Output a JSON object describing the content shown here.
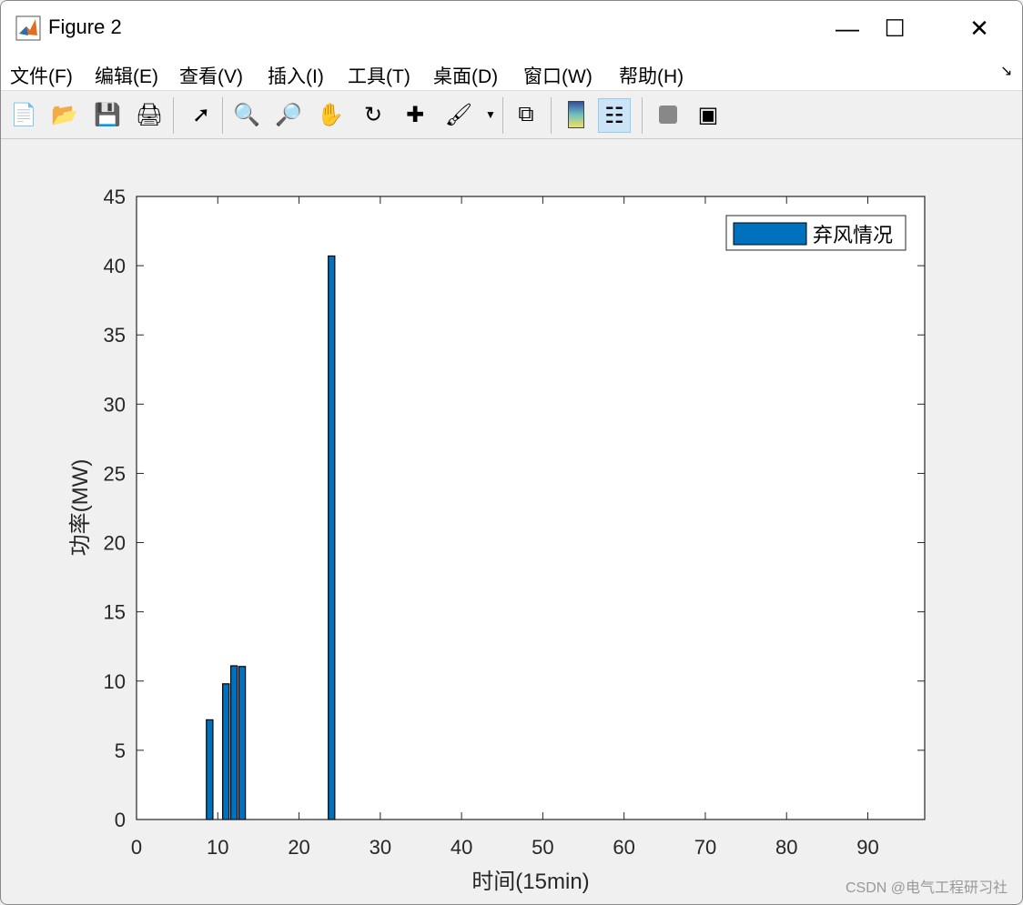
{
  "window": {
    "title": "Figure 2",
    "minimize": "—",
    "maximize": "☐",
    "close": "✕"
  },
  "menu": [
    "文件(F)",
    "编辑(E)",
    "查看(V)",
    "插入(I)",
    "工具(T)",
    "桌面(D)",
    "窗口(W)",
    "帮助(H)"
  ],
  "toolbar": [
    "new-file",
    "open-folder",
    "save",
    "print",
    "select-pointer",
    "zoom-in",
    "zoom-out",
    "pan-hand",
    "rotate-3d",
    "data-cursor",
    "brush",
    "link-plot",
    "colorbar",
    "legend",
    "hide-plot-tools",
    "show-plot-tools"
  ],
  "watermark": "CSDN @电气工程研习社",
  "chart_data": {
    "type": "bar",
    "x": [
      9,
      11,
      12,
      13,
      24
    ],
    "values": [
      7.2,
      9.8,
      11.1,
      11.05,
      40.7
    ],
    "series": [
      {
        "name": "弃风情况",
        "color": "#0072bd"
      }
    ],
    "xlabel": "时间(15min)",
    "ylabel": "功率(MW)",
    "xlim": [
      0,
      97
    ],
    "ylim": [
      0,
      45
    ],
    "xticks": [
      0,
      10,
      20,
      30,
      40,
      50,
      60,
      70,
      80,
      90
    ],
    "yticks": [
      0,
      5,
      10,
      15,
      20,
      25,
      30,
      35,
      40,
      45
    ],
    "legend_position": "top-right",
    "grid": false
  }
}
